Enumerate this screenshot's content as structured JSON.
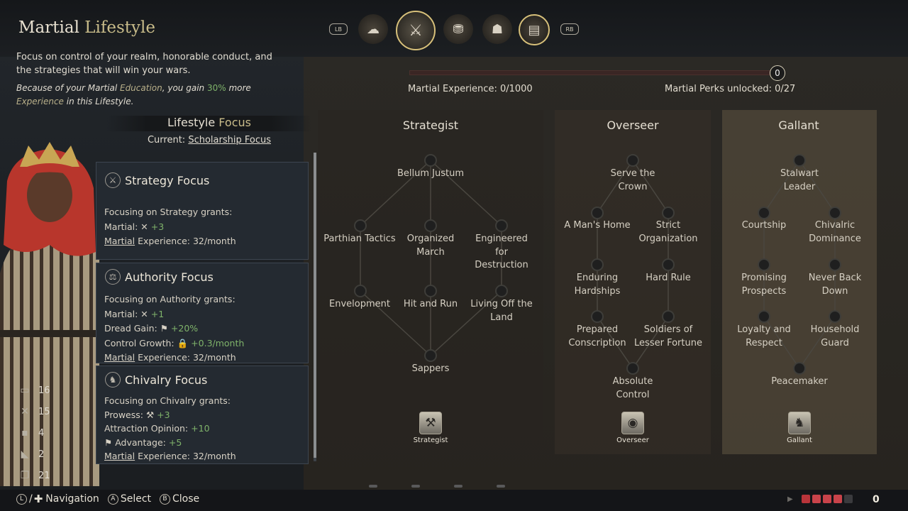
{
  "header": {
    "title_main": "Martial",
    "title_accent": "Lifestyle",
    "description": "Focus on control of your realm, honorable conduct, and the strategies that will win your wars.",
    "bonus": {
      "pre": "Because of your Martial ",
      "skill": "Education",
      "mid": ", you gain ",
      "pct": "30%",
      "post1": " more",
      "post2": "Experience",
      "post3": " in this Lifestyle."
    }
  },
  "tabs": {
    "lb": "LB",
    "rb": "RB",
    "items": [
      {
        "name": "diplomacy",
        "glyph": "☁"
      },
      {
        "name": "martial",
        "glyph": "⚔"
      },
      {
        "name": "stewardship",
        "glyph": "⛃"
      },
      {
        "name": "intrigue",
        "glyph": "☗"
      },
      {
        "name": "learning",
        "glyph": "▤"
      }
    ],
    "active": "martial"
  },
  "lifestyle_focus": {
    "heading_main": "Lifestyle",
    "heading_accent": "Focus",
    "current_label": "Current:",
    "current_value": "Scholarship Focus"
  },
  "focus_panels": [
    {
      "name": "Strategy Focus",
      "icon": "⚔",
      "grants": "Focusing on Strategy grants:",
      "lines": [
        {
          "label": "Martial:",
          "icon": "✕",
          "value": "+3"
        },
        {
          "label": "Martial",
          "rest": " Experience: 32/month"
        }
      ]
    },
    {
      "name": "Authority Focus",
      "icon": "⚖",
      "grants": "Focusing on Authority grants:",
      "lines": [
        {
          "label": "Martial:",
          "icon": "✕",
          "value": "+1"
        },
        {
          "label": "Dread Gain:",
          "icon": "⚑",
          "value": "+20%"
        },
        {
          "label": "Control Growth:",
          "icon": "🔒",
          "value": "+0.3/month"
        },
        {
          "label": "Martial",
          "rest": " Experience: 32/month"
        }
      ]
    },
    {
      "name": "Chivalry Focus",
      "icon": "♞",
      "grants": "Focusing on Chivalry grants:",
      "lines": [
        {
          "label": "Prowess:",
          "icon": "⚒",
          "value": "+3"
        },
        {
          "label": "Attraction Opinion:",
          "value": "+10"
        },
        {
          "label": "Advantage:",
          "icon": "⚑",
          "value": "+5"
        },
        {
          "label": "Martial",
          "rest": " Experience: 32/month"
        }
      ]
    }
  ],
  "stats": [
    {
      "icon": "▭",
      "value": "16"
    },
    {
      "icon": "✕",
      "value": "15"
    },
    {
      "icon": "▪",
      "value": "4"
    },
    {
      "icon": "◣",
      "value": "2"
    },
    {
      "icon": "❐",
      "value": "21"
    }
  ],
  "experience": {
    "label": "Martial Experience: 0/1000",
    "progress": 0,
    "counter": "0",
    "perks": "Martial Perks unlocked: 0/27"
  },
  "trees": {
    "strategist": {
      "title": "Strategist",
      "icon_label": "Strategist",
      "perks": [
        "Bellum Justum",
        "Parthian Tactics",
        "Organized March",
        "Engineered for Destruction",
        "Envelopment",
        "Hit and Run",
        "Living Off the Land",
        "Sappers"
      ]
    },
    "overseer": {
      "title": "Overseer",
      "icon_label": "Overseer",
      "perks": [
        "Serve the Crown",
        "A Man's Home",
        "Strict Organization",
        "Enduring Hardships",
        "Hard Rule",
        "Prepared Conscription",
        "Soldiers of Lesser Fortune",
        "Absolute Control"
      ]
    },
    "gallant": {
      "title": "Gallant",
      "icon_label": "Gallant",
      "perks": [
        "Stalwart Leader",
        "Courtship",
        "Chivalric Dominance",
        "Promising Prospects",
        "Never Back Down",
        "Loyalty and Respect",
        "Household Guard",
        "Peacemaker"
      ]
    }
  },
  "controls": {
    "nav_btn": "L",
    "nav_label": "Navigation",
    "select_btn": "A",
    "select_label": "Select",
    "close_btn": "B",
    "close_label": "Close"
  },
  "notifications": {
    "count": "0",
    "colors": [
      "#b8343a",
      "#c8434a",
      "#c8434a",
      "#c8434a",
      "#3a3a3d"
    ]
  }
}
